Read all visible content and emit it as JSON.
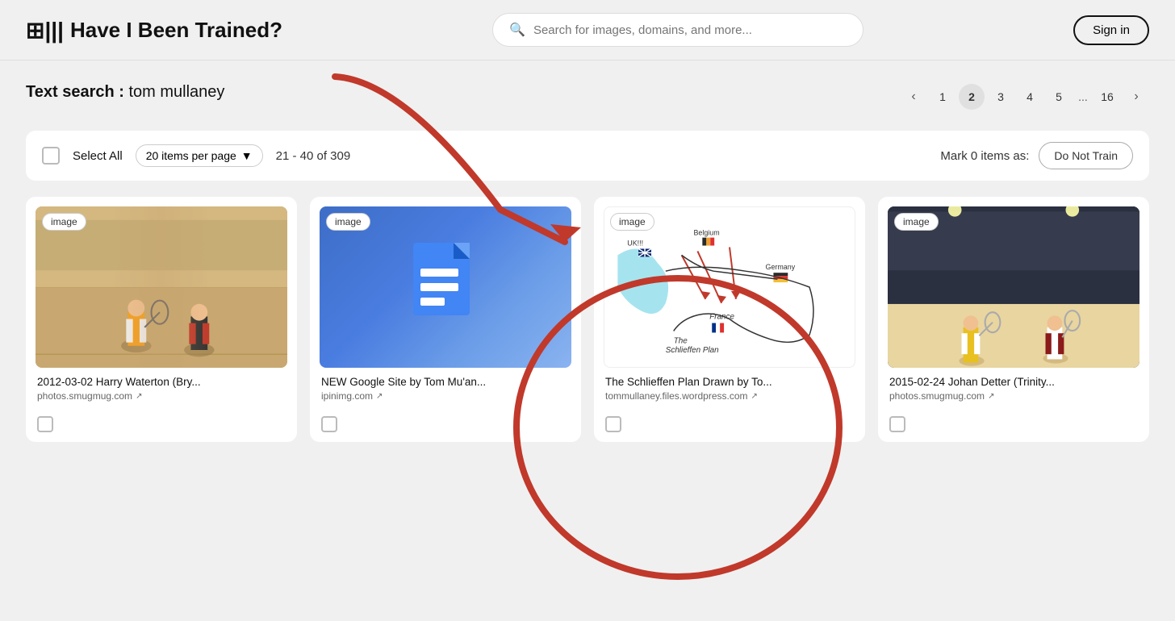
{
  "header": {
    "logo_icon": "⊞|||",
    "logo_text": "Have I Been Trained?",
    "search_placeholder": "Search for images, domains, and more...",
    "sign_in_label": "Sign in"
  },
  "search": {
    "label_key": "Text search :",
    "label_val": "tom mullaney"
  },
  "pagination": {
    "prev_label": "‹",
    "next_label": "›",
    "pages": [
      "1",
      "2",
      "3",
      "4",
      "5",
      "...",
      "16"
    ],
    "active_page": "2"
  },
  "toolbar": {
    "select_all_label": "Select All",
    "items_per_page_label": "20 items per page",
    "items_count": "21 - 40 of 309",
    "mark_label": "Mark 0 items as:",
    "do_not_train_label": "Do Not Train"
  },
  "cards": [
    {
      "id": "card-1",
      "badge": "image",
      "title": "2012-03-02 Harry Waterton (Bry...",
      "source": "photos.smugmug.com",
      "type": "squash"
    },
    {
      "id": "card-2",
      "badge": "image",
      "title": "NEW Google Site by Tom Mu’an...",
      "source": "ipinimg.com",
      "type": "gdoc"
    },
    {
      "id": "card-3",
      "badge": "image",
      "title": "The Schlieffen Plan Drawn by To...",
      "source": "tommullaney.files.wordpress.com",
      "type": "map"
    },
    {
      "id": "card-4",
      "badge": "image",
      "title": "2015-02-24 Johan Detter (Trinity...",
      "source": "photos.smugmug.com",
      "type": "squash2"
    }
  ]
}
